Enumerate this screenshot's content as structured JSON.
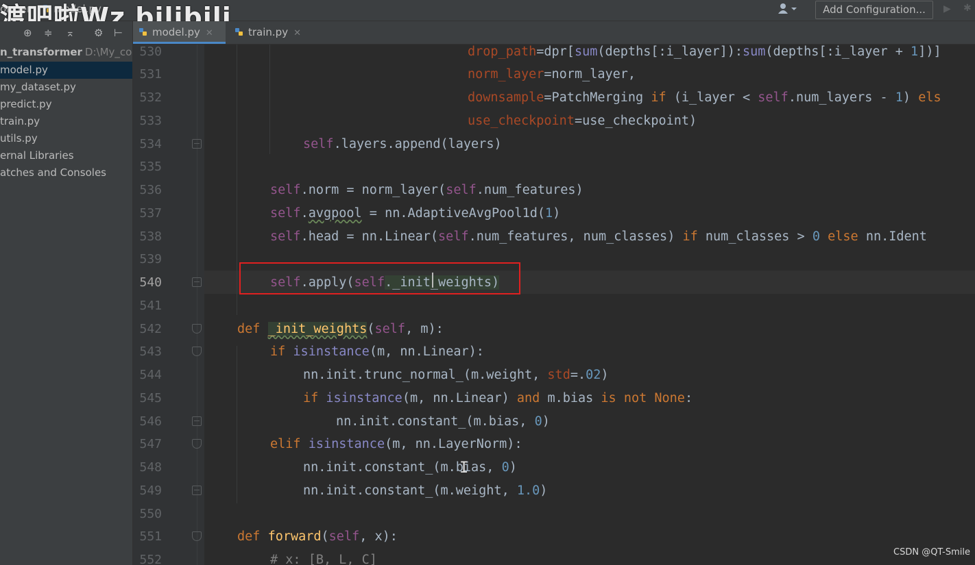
{
  "topbar": {
    "project_crumb": "ormer",
    "file_crumb": "model.py",
    "watermark": "渡吧啦Wz bilibili",
    "run_config_button": "Add Configuration..."
  },
  "sidebar": {
    "root_name": "n_transformer",
    "root_path": "D:\\My_code",
    "items": [
      {
        "label": "model.py",
        "selected": true
      },
      {
        "label": "my_dataset.py"
      },
      {
        "label": "predict.py"
      },
      {
        "label": "train.py"
      },
      {
        "label": "utils.py"
      },
      {
        "label": "ernal Libraries"
      },
      {
        "label": "atches and Consoles"
      }
    ]
  },
  "tabs": [
    {
      "label": "model.py",
      "active": true
    },
    {
      "label": "train.py",
      "active": false
    }
  ],
  "editor": {
    "current_line": 540,
    "line_numbers": [
      "530",
      "531",
      "532",
      "533",
      "534",
      "535",
      "536",
      "537",
      "538",
      "539",
      "540",
      "541",
      "542",
      "543",
      "544",
      "545",
      "546",
      "547",
      "548",
      "549",
      "550",
      "551",
      "552"
    ]
  },
  "code": {
    "l530": {
      "a": "drop_path",
      "b": "=dpr[",
      "c": "sum",
      "d": "(depths[:i_layer]):",
      "e": "sum",
      "f": "(depths[:i_layer + ",
      "g": "1",
      "h": "])]"
    },
    "l531": {
      "a": "norm_layer",
      "b": "=norm_layer,"
    },
    "l532": {
      "a": "downsample",
      "b": "=PatchMerging ",
      "c": "if",
      "d": " (i_layer < ",
      "e": "self",
      "f": ".num_layers - ",
      "g": "1",
      "h": ") ",
      "i": "els"
    },
    "l533": {
      "a": "use_checkpoint",
      "b": "=use_checkpoint)"
    },
    "l534": {
      "a": "self",
      "b": ".layers.append(layers)"
    },
    "l536": {
      "a": "self",
      "b": ".norm = norm_layer(",
      "c": "self",
      "d": ".num_features)"
    },
    "l537": {
      "a": "self",
      "b": ".",
      "c": "avgpool",
      "d": " = nn.AdaptiveAvgPool1d(",
      "e": "1",
      "f": ")"
    },
    "l538": {
      "a": "self",
      "b": ".head = nn.Linear(",
      "c": "self",
      "d": ".num_features, num_classes) ",
      "e": "if",
      "f": " num_classes > ",
      "g": "0",
      "h": " ",
      "i": "else",
      "j": " nn.Ident"
    },
    "l540": {
      "a": "self",
      "b": ".apply(",
      "c": "self",
      "d": "._init_weights)"
    },
    "l542": {
      "a": "def",
      "b": " ",
      "c": "_init_weights",
      "d": "(",
      "e": "self",
      "f": ", m):"
    },
    "l543": {
      "a": "if",
      "b": " ",
      "c": "isinstance",
      "d": "(m, nn.Linear):"
    },
    "l544": {
      "a": "nn.init.trunc_normal_(m.weight, ",
      "b": "std",
      "c": "=.",
      "d": "02",
      "e": ")"
    },
    "l545": {
      "a": "if",
      "b": " ",
      "c": "isinstance",
      "d": "(m, nn.Linear) ",
      "e": "and",
      "f": " m.bias ",
      "g": "is not",
      "h": " ",
      "i": "None",
      "j": ":"
    },
    "l546": {
      "a": "nn.init.constant_(m.bias, ",
      "b": "0",
      "c": ")"
    },
    "l547": {
      "a": "elif",
      "b": " ",
      "c": "isinstance",
      "d": "(m, nn.LayerNorm):"
    },
    "l548": {
      "a": "nn.init.constant_(m.bias, ",
      "b": "0",
      "c": ")"
    },
    "l549": {
      "a": "nn.init.constant_(m.weight, ",
      "b": "1.0",
      "c": ")"
    },
    "l551": {
      "a": "def",
      "b": " ",
      "c": "forward",
      "d": "(",
      "e": "self",
      "f": ", x):"
    },
    "l552": {
      "a": "# x: [B, L, C]"
    }
  },
  "credit": "CSDN @QT-Smile",
  "colors": {
    "keyword": "#cc7832",
    "self": "#94558d",
    "param": "#aa4926",
    "number": "#6897bb",
    "builtin": "#8888c6",
    "function": "#ffc66d",
    "comment": "#808080",
    "annotation_box": "#e02020"
  }
}
